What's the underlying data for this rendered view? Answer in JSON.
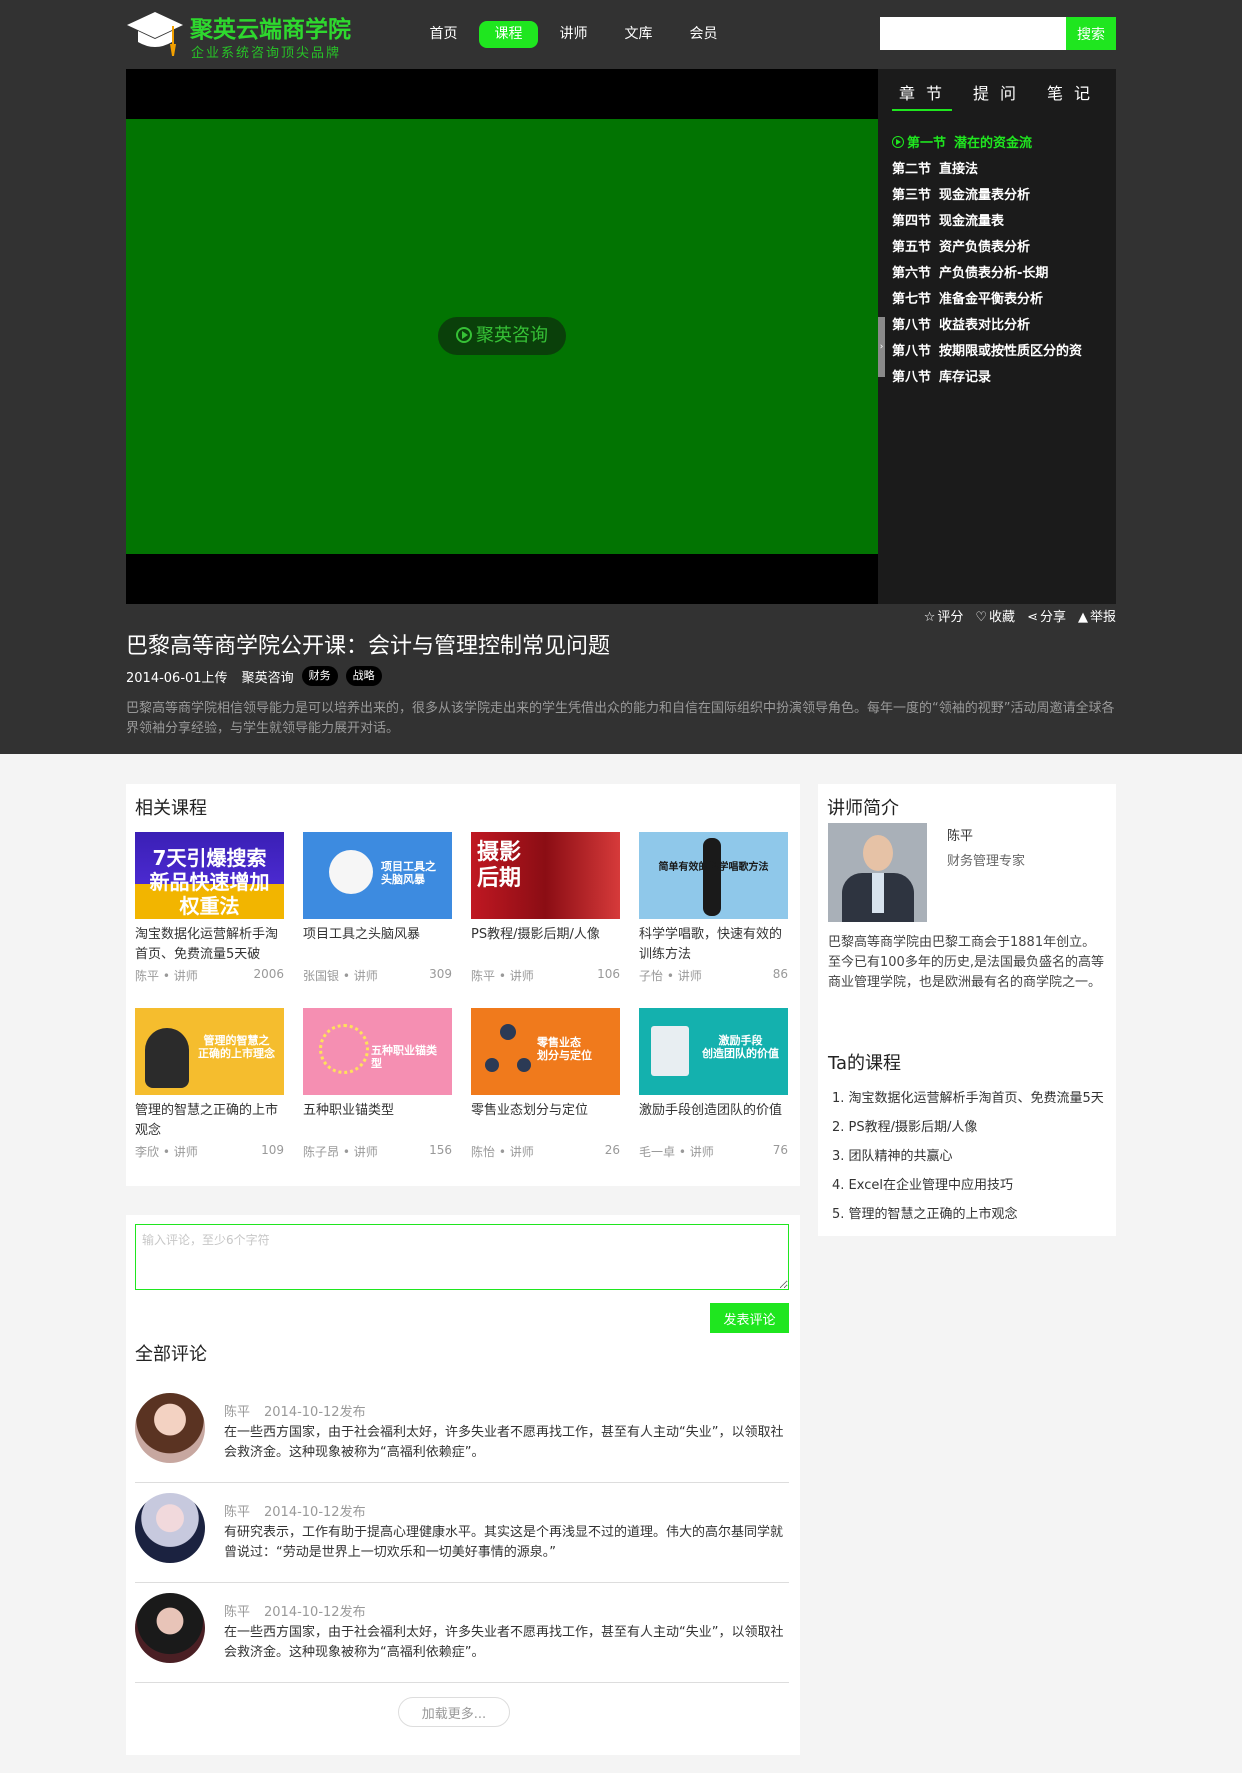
{
  "brand": {
    "title": "聚英云端商学院",
    "subtitle": "企业系统咨询顶尖品牌",
    "accent": "#1fe61f"
  },
  "nav": {
    "items": [
      {
        "label": "首页",
        "active": false
      },
      {
        "label": "课程",
        "active": true
      },
      {
        "label": "讲师",
        "active": false
      },
      {
        "label": "文库",
        "active": false
      },
      {
        "label": "会员",
        "active": false
      }
    ]
  },
  "search": {
    "placeholder": "",
    "button": "搜索"
  },
  "player": {
    "badge": "聚英咨询",
    "video_color": "#027402"
  },
  "chapters": {
    "tabs": [
      "章 节",
      "提 问",
      "笔 记"
    ],
    "items": [
      {
        "no": "第一节",
        "title": "潜在的资金流",
        "active": true
      },
      {
        "no": "第二节",
        "title": "直接法",
        "active": false
      },
      {
        "no": "第三节",
        "title": "现金流量表分析",
        "active": false
      },
      {
        "no": "第四节",
        "title": "现金流量表",
        "active": false
      },
      {
        "no": "第五节",
        "title": "资产负债表分析",
        "active": false
      },
      {
        "no": "第六节",
        "title": "产负债表分析-长期",
        "active": false
      },
      {
        "no": "第七节",
        "title": "准备金平衡表分析",
        "active": false
      },
      {
        "no": "第八节",
        "title": "收益表对比分析",
        "active": false
      },
      {
        "no": "第八节",
        "title": "按期限或按性质区分的资",
        "active": false
      },
      {
        "no": "第八节",
        "title": "库存记录",
        "active": false
      }
    ]
  },
  "actions": [
    {
      "icon": "star-icon",
      "glyph": "☆",
      "label": "评分"
    },
    {
      "icon": "heart-icon",
      "glyph": "♡",
      "label": "收藏"
    },
    {
      "icon": "share-icon",
      "glyph": "⋖",
      "label": "分享"
    },
    {
      "icon": "warning-icon",
      "glyph": "▲",
      "label": "举报"
    }
  ],
  "course": {
    "title": "巴黎高等商学院公开课：会计与管理控制常见问题",
    "upload": "2014-06-01上传",
    "org": "聚英咨询",
    "tags": [
      "财务",
      "战略"
    ],
    "description": "巴黎高等商学院相信领导能力是可以培养出来的，很多从该学院走出来的学生凭借出众的能力和自信在国际组织中扮演领导角色。每年一度的“领袖的视野”活动周邀请全球各界领袖分享经验，与学生就领导能力展开对话。"
  },
  "related": {
    "title": "相关课程",
    "cards": [
      {
        "title": "淘宝数据化运营解析手淘首页、免费流量5天破",
        "teacher": "陈平 • 讲师",
        "count": "2006",
        "thumb_text": "7天引爆搜索\n新品快速增加权重法",
        "thumb_bg": "#3a1fb5"
      },
      {
        "title": "项目工具之头脑风暴",
        "teacher": "张国银 • 讲师",
        "count": "309",
        "thumb_text": "项目工具之\n头脑风暴",
        "thumb_bg": "#3d8be0"
      },
      {
        "title": "PS教程/摄影后期/人像",
        "teacher": "陈平 • 讲师",
        "count": "106",
        "thumb_text": "摄影\n后期",
        "thumb_bg": "#b3121b"
      },
      {
        "title": "科学学唱歌，快速有效的训练方法",
        "teacher": "子怡 • 讲师",
        "count": "86",
        "thumb_text": "简单有效的科学唱歌方法",
        "thumb_bg": "#8fc8ea"
      },
      {
        "title": "管理的智慧之正确的上市观念",
        "teacher": "李欣 • 讲师",
        "count": "109",
        "thumb_text": "管理的智慧之\n正确的上市理念",
        "thumb_bg": "#f5bd2e"
      },
      {
        "title": "五种职业锚类型",
        "teacher": "陈子昂 • 讲师",
        "count": "156",
        "thumb_text": "五种职业锚类型",
        "thumb_bg": "#f58fb2"
      },
      {
        "title": "零售业态划分与定位",
        "teacher": "陈怡 • 讲师",
        "count": "26",
        "thumb_text": "零售业态\n划分与定位",
        "thumb_bg": "#f07a1c"
      },
      {
        "title": "激励手段创造团队的价值",
        "teacher": "毛一卓 • 讲师",
        "count": "76",
        "thumb_text": "激励手段\n创造团队的价值",
        "thumb_bg": "#14b1ae"
      }
    ]
  },
  "comments": {
    "placeholder": "输入评论，至少6个字符",
    "submit": "发表评论",
    "title": "全部评论",
    "items": [
      {
        "name": "陈平",
        "time": "2014-10-12发布",
        "text": "在一些西方国家，由于社会福利太好，许多失业者不愿再找工作，甚至有人主动“失业”，以领取社会救济金。这种现象被称为“高福利依赖症”。"
      },
      {
        "name": "陈平",
        "time": "2014-10-12发布",
        "text": "有研究表示，工作有助于提高心理健康水平。其实这是个再浅显不过的道理。伟大的高尔基同学就曾说过：“劳动是世界上一切欢乐和一切美好事情的源泉。”"
      },
      {
        "name": "陈平",
        "time": "2014-10-12发布",
        "text": "在一些西方国家，由于社会福利太好，许多失业者不愿再找工作，甚至有人主动“失业”，以领取社会救济金。这种现象被称为“高福利依赖症”。"
      }
    ],
    "load_more": "加载更多..."
  },
  "teacher": {
    "section_title": "讲师简介",
    "name": "陈平",
    "role": "财务管理专家",
    "intro": "巴黎高等商学院由巴黎工商会于1881年创立。至今已有100多年的历史,是法国最负盛名的高等商业管理学院，也是欧洲最有名的商学院之一。",
    "courses_title": "Ta的课程",
    "courses": [
      "1. 淘宝数据化运营解析手淘首页、免费流量5天",
      "2. PS教程/摄影后期/人像",
      "3. 团队精神的共赢心",
      "4. Excel在企业管理中应用技巧",
      "5. 管理的智慧之正确的上市观念"
    ]
  }
}
